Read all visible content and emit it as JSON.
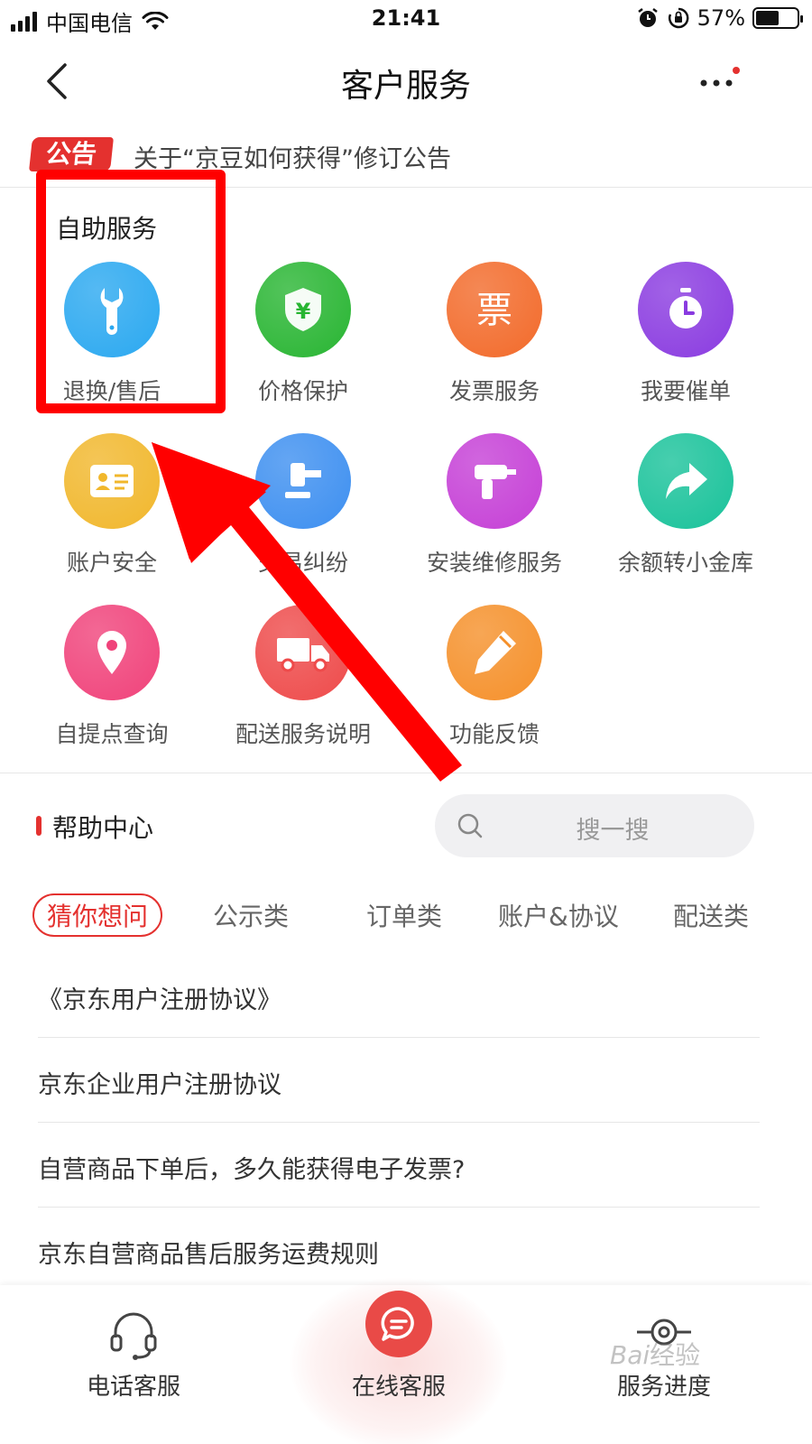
{
  "status_bar": {
    "carrier": "中国电信",
    "time": "21:41",
    "battery_percent": "57%",
    "battery_level": 0.57
  },
  "nav": {
    "title": "客户服务"
  },
  "notice": {
    "badge": "公告",
    "text": "关于“京豆如何获得”修订公告"
  },
  "self_service": {
    "title": "自助服务",
    "items": [
      {
        "label": "退换/售后",
        "icon": "wrench-icon",
        "color": "#2aa8f0"
      },
      {
        "label": "价格保护",
        "icon": "shield-yen-icon",
        "color": "#28b532"
      },
      {
        "label": "发票服务",
        "icon": "invoice-icon",
        "color": "#f26a2a"
      },
      {
        "label": "我要催单",
        "icon": "stopwatch-icon",
        "color": "#8a3be0"
      },
      {
        "label": "账户安全",
        "icon": "id-card-icon",
        "color": "#f1b72c"
      },
      {
        "label": "交易纠纷",
        "icon": "gavel-icon",
        "color": "#3d8ff0"
      },
      {
        "label": "安装维修服务",
        "icon": "drill-icon",
        "color": "#c53fd6"
      },
      {
        "label": "余额转小金库",
        "icon": "share-arrow-icon",
        "color": "#19c29a"
      },
      {
        "label": "自提点查询",
        "icon": "location-pin-icon",
        "color": "#f0427a"
      },
      {
        "label": "配送服务说明",
        "icon": "truck-icon",
        "color": "#ee4a4a"
      },
      {
        "label": "功能反馈",
        "icon": "pencil-icon",
        "color": "#f5902a"
      }
    ]
  },
  "help_center": {
    "title": "帮助中心",
    "search_placeholder": "搜一搜",
    "tabs": [
      "猜你想问",
      "公示类",
      "订单类",
      "账户&协议",
      "配送类"
    ],
    "questions": [
      "《京东用户注册协议》",
      "京东企业用户注册协议",
      "自营商品下单后，多久能获得电子发票?",
      "京东自营商品售后服务运费规则"
    ]
  },
  "bottom_bar": {
    "items": [
      {
        "label": "电话客服",
        "icon": "headset-icon"
      },
      {
        "label": "在线客服",
        "icon": "chat-bubble-icon"
      },
      {
        "label": "服务进度",
        "icon": "progress-icon"
      }
    ]
  },
  "accent_color": "#e4312f",
  "annotation_color": "#ff0000"
}
